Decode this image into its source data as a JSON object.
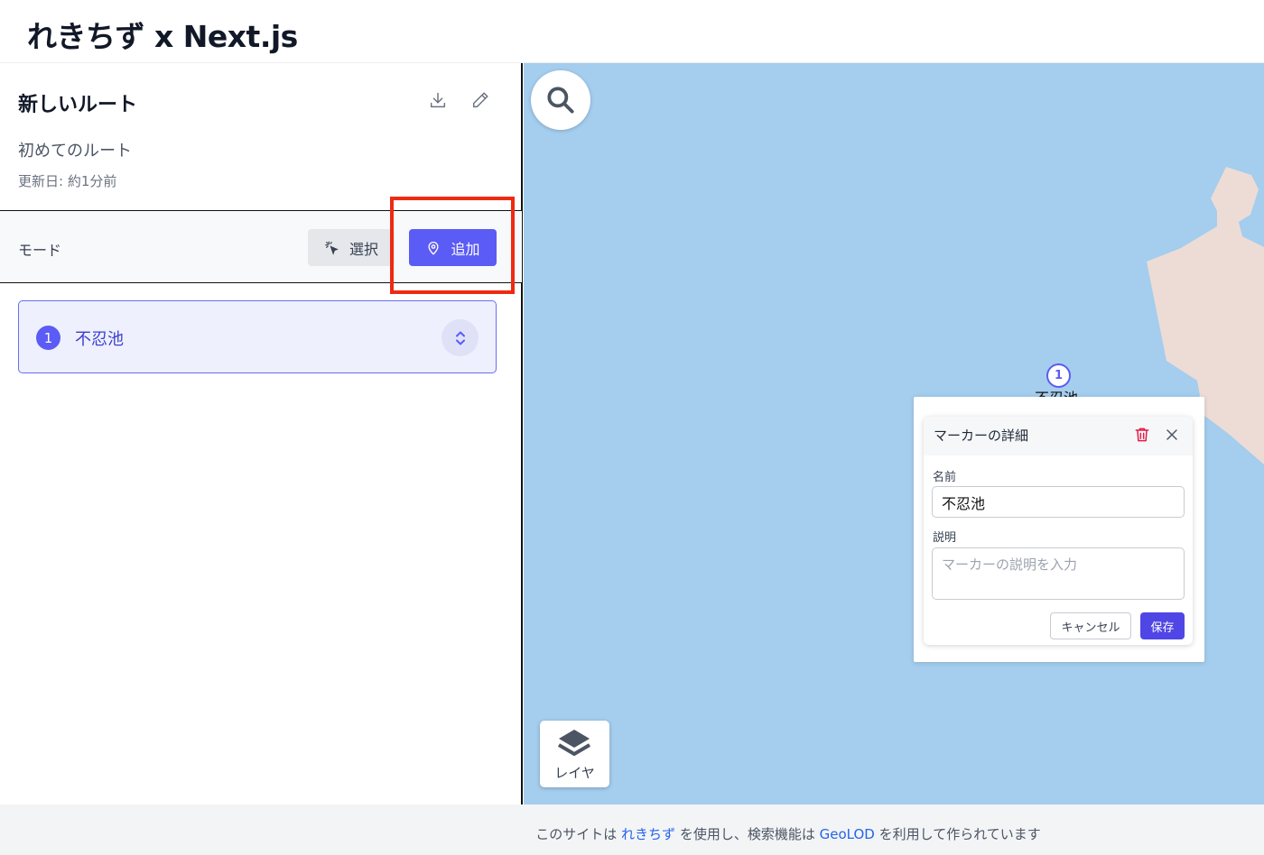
{
  "app": {
    "title": "れきちず x Next.js"
  },
  "route": {
    "title": "新しいルート",
    "description": "初めてのルート",
    "updated": "更新日: 約1分前"
  },
  "mode": {
    "label": "モード",
    "select_label": "選択",
    "add_label": "追加",
    "active": "追加"
  },
  "markers": [
    {
      "number": "1",
      "name": "不忍池"
    }
  ],
  "map": {
    "layer_label": "レイヤ",
    "marker_number": "1",
    "marker_label": "不忍池"
  },
  "popup": {
    "title": "マーカーの詳細",
    "name_label": "名前",
    "name_value": "不忍池",
    "desc_label": "説明",
    "desc_placeholder": "マーカーの説明を入力",
    "cancel_label": "キャンセル",
    "save_label": "保存"
  },
  "footer": {
    "prefix": "このサイトは",
    "link1": "れきちず",
    "middle": "を使用し、検索機能は",
    "link2": "GeoLOD",
    "suffix": "を利用して作られています"
  },
  "colors": {
    "accent": "#5b5bf5",
    "map_water": "#a4cdee",
    "map_land": "#eddcd5",
    "highlight": "#ee2a12",
    "delete": "#e11d48"
  }
}
